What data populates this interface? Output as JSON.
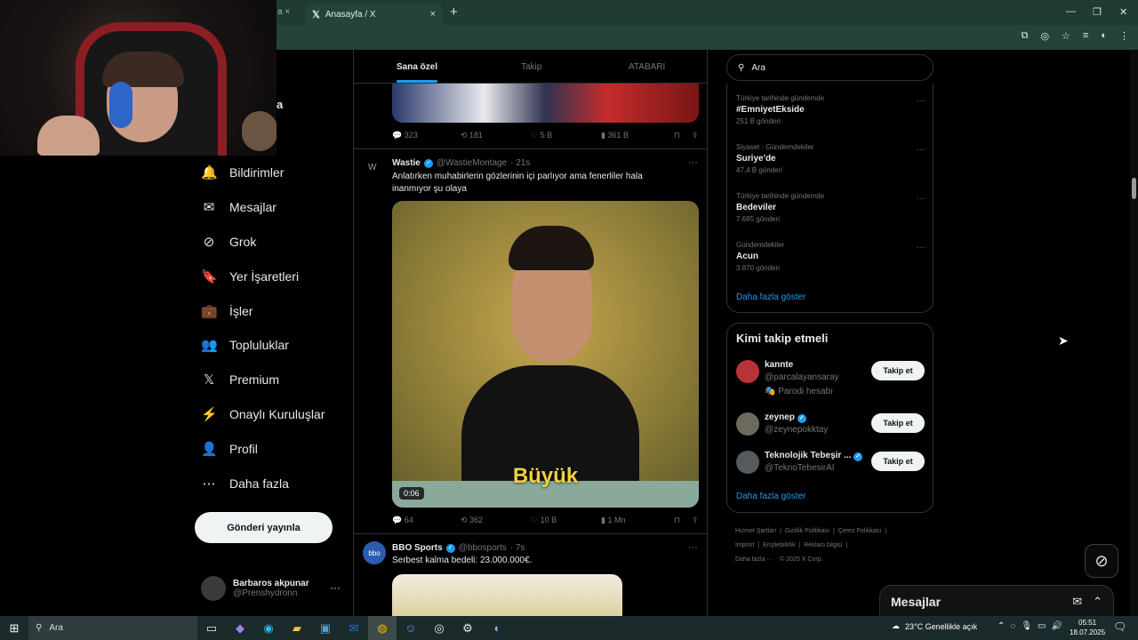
{
  "browser": {
    "prev_tab_fragment": "a",
    "active_tab_title": "Anasayfa / X",
    "tab_close": "×",
    "new_tab": "+",
    "window_controls": [
      "—",
      "❐",
      "✕"
    ]
  },
  "nav": {
    "top_partial_label": "a",
    "items": [
      {
        "label": "Bildirimler",
        "icon": "bell-icon",
        "glyph": "🔔"
      },
      {
        "label": "Mesajlar",
        "icon": "mail-icon",
        "glyph": "✉"
      },
      {
        "label": "Grok",
        "icon": "grok-icon",
        "glyph": "⊘"
      },
      {
        "label": "Yer İşaretleri",
        "icon": "bookmark-icon",
        "glyph": "🔖"
      },
      {
        "label": "İşler",
        "icon": "briefcase-icon",
        "glyph": "💼"
      },
      {
        "label": "Topluluklar",
        "icon": "communities-icon",
        "glyph": "👥"
      },
      {
        "label": "Premium",
        "icon": "x-logo-icon",
        "glyph": "𝕏"
      },
      {
        "label": "Onaylı Kuruluşlar",
        "icon": "lightning-icon",
        "glyph": "⚡"
      },
      {
        "label": "Profil",
        "icon": "person-icon",
        "glyph": "👤"
      },
      {
        "label": "Daha fazla",
        "icon": "more-circle-icon",
        "glyph": "⋯"
      }
    ],
    "post_button": "Gönderi yayınla",
    "account": {
      "name": "Barbaros akpunar",
      "handle": "@Prenshydronn",
      "more": "···"
    }
  },
  "timeline": {
    "tabs": [
      "Sana özel",
      "Takip",
      "ATABARI"
    ],
    "first_tweet_actions": {
      "replies": "323",
      "reposts": "181",
      "likes": "5 B",
      "views": "361 B"
    },
    "tweet2": {
      "avatar_label": "W",
      "name": "Wastie",
      "handle": "@WastieMontage",
      "time": "· 21s",
      "text": "Anlatırken muhabirlerin gözlerinin içi parlıyor ama fenerliler hala inanmıyor şu olaya",
      "video_caption": "Büyük",
      "video_duration": "0:06",
      "replies": "64",
      "reposts": "362",
      "likes": "10 B",
      "views": "1 Mn"
    },
    "tweet3": {
      "avatar_label": "bbo",
      "name": "BBO Sports",
      "handle": "@bbosports",
      "time": "· 7s",
      "text": "Serbest kalma bedeli: 23.000.000€."
    },
    "more": "···"
  },
  "search": {
    "placeholder": "Ara",
    "value": "Ara"
  },
  "trends": {
    "items": [
      {
        "context": "Türkiye tarihinde gündemde",
        "title": "#EmniyetEkside",
        "count": "251 B gönderi"
      },
      {
        "context": "Siyaset · Gündemdekiler",
        "title": "Suriye'de",
        "count": "47,4 B gönderi"
      },
      {
        "context": "Türkiye tarihinde gündemde",
        "title": "Bedeviler",
        "count": "7.685 gönderi"
      },
      {
        "context": "Gündemdekiler",
        "title": "Acun",
        "count": "3.870 gönderi"
      }
    ],
    "show_more": "Daha fazla göster"
  },
  "who_to_follow": {
    "title": "Kimi takip etmeli",
    "users": [
      {
        "name": "kannte",
        "handle": "@parcalayansaray",
        "extra": "🎭 Parodi hesabı",
        "button": "Takip et",
        "avatar_color": "#b8323a"
      },
      {
        "name": "zeynep",
        "handle": "@zeynepokktay",
        "extra": "",
        "button": "Takip et",
        "avatar_color": "#6d6a5c"
      },
      {
        "name": "Teknolojik Tebeşir ...",
        "handle": "@TeknoTebesirAI",
        "extra": "",
        "button": "Takip et",
        "avatar_color": "#555a5e"
      }
    ],
    "show_more": "Daha fazla göster"
  },
  "footer": {
    "links": [
      "Hizmet Şartları",
      "Gizlilik Politikası",
      "Çerez Politikası",
      "Imprint",
      "Erişilebilirlik",
      "Reklam bilgisi",
      "Daha fazla ···",
      "© 2025 X Corp."
    ]
  },
  "messages_dock": {
    "title": "Mesajlar"
  },
  "taskbar": {
    "search_placeholder": "Ara",
    "weather": "23°C  Genellikle açık",
    "time": "05:51",
    "date": "18.07.2025"
  },
  "colors": {
    "accent": "#1d9bf0",
    "chrome": "#1f3b33",
    "background": "#000000"
  }
}
